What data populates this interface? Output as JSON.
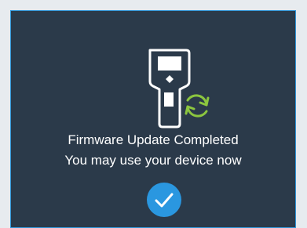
{
  "dialog": {
    "title_line": "Firmware Update Completed",
    "message_line": "You may use your device now"
  },
  "icons": {
    "device": "device-icon",
    "sync": "sync-arrows-icon",
    "confirm": "checkmark-icon"
  },
  "colors": {
    "panel_background": "#2b3a4a",
    "panel_border": "#2f95d8",
    "text": "#ffffff",
    "sync_accent": "#8cc63f",
    "confirm_button": "#2a97e0"
  }
}
